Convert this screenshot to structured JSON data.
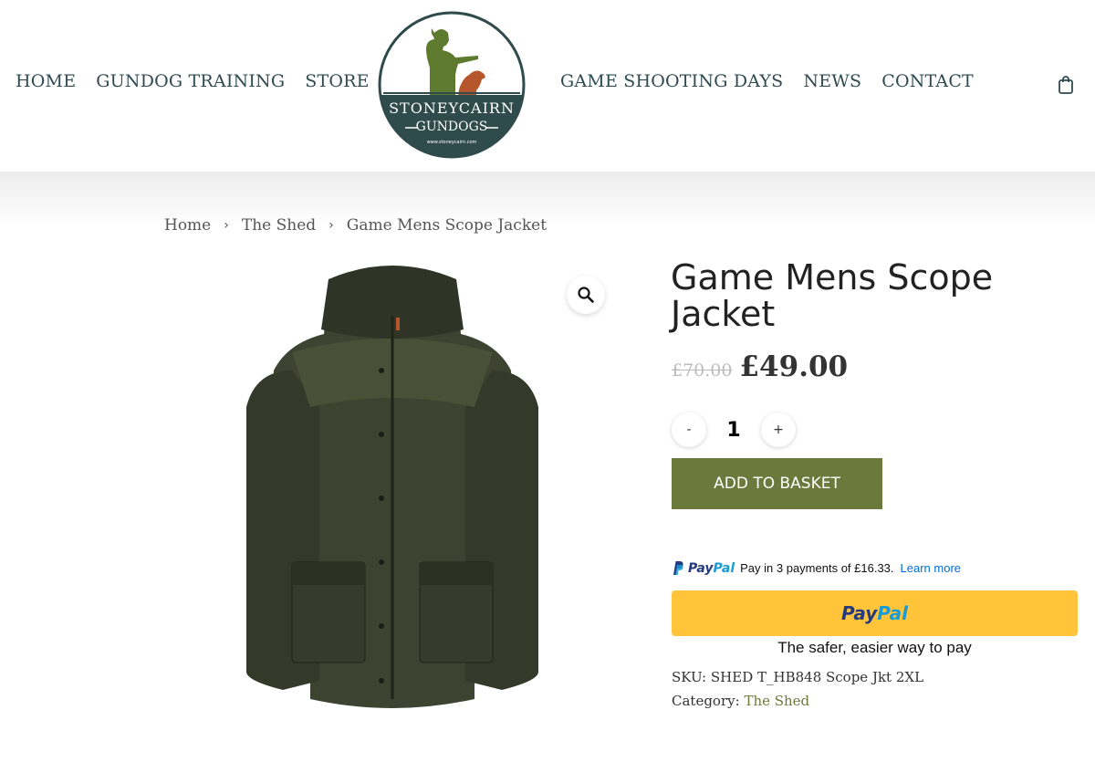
{
  "nav": {
    "left": [
      "HOME",
      "GUNDOG TRAINING",
      "STORE"
    ],
    "right": [
      "GAME SHOOTING DAYS",
      "NEWS",
      "CONTACT"
    ]
  },
  "logo": {
    "line1": "STONEYCAIRN",
    "line2": "GUNDOGS",
    "url_text": "www.stoneycairn.com",
    "colors": {
      "green": "#5e7a2e",
      "dark": "#2f4b4b",
      "dog": "#b5562c"
    }
  },
  "header": {
    "cart_icon": "shopping-bag-icon"
  },
  "breadcrumb": {
    "items": [
      "Home",
      "The Shed",
      "Game Mens Scope Jacket"
    ],
    "separator": "›"
  },
  "product": {
    "title": "Game Mens Scope Jacket",
    "price_old": "£70.00",
    "price_new": "£49.00",
    "quantity": "1",
    "qty_minus": "-",
    "qty_plus": "+",
    "add_to_basket": "ADD TO BASKET",
    "zoom_icon": "magnifier-icon",
    "sku_label": "SKU:",
    "sku_value": "SHED T_HB848 Scope Jkt 2XL",
    "category_label": "Category:",
    "category_value": "The Shed"
  },
  "paypal": {
    "brand_pay": "Pay",
    "brand_pal": "Pal",
    "message": "Pay in 3 payments of £16.33.",
    "learn_more": "Learn more",
    "tagline": "The safer, easier way to pay"
  },
  "colors": {
    "accent_green": "#6b7a3c",
    "paypal_yellow": "#ffc439",
    "paypal_dark_blue": "#253b80",
    "paypal_light_blue": "#179bd7",
    "nav_text": "#2f4b52"
  }
}
